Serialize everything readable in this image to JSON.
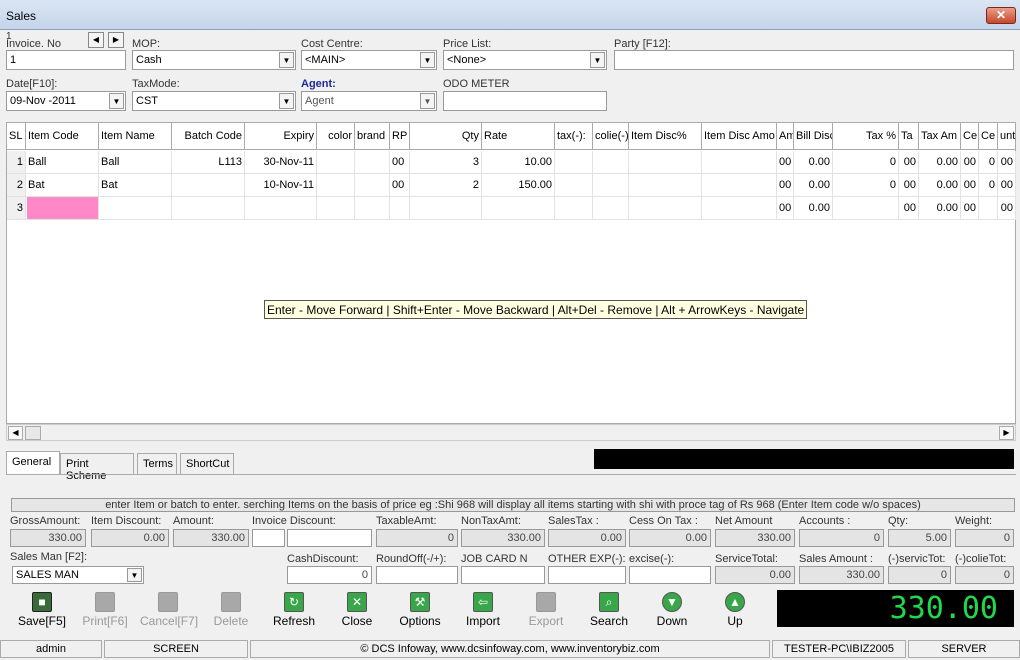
{
  "window": {
    "title": "Sales",
    "close_symbol": "✕"
  },
  "header": {
    "row_marker": "1",
    "invoice_label": "Invoice. No",
    "invoice_value": "1",
    "mop_label": "MOP:",
    "mop_value": "Cash",
    "cost_centre_label": "Cost Centre:",
    "cost_centre_value": "<MAIN>",
    "price_list_label": "Price List:",
    "price_list_value": "<None>",
    "party_label": "Party [F12]:",
    "party_value": "",
    "date_label": "Date[F10]:",
    "date_value": "09-Nov -2011",
    "taxmode_label": "TaxMode:",
    "taxmode_value": "CST",
    "agent_label": "Agent:",
    "agent_value": "Agent",
    "odo_label": "ODO METER",
    "odo_value": ""
  },
  "grid": {
    "columns": [
      "SL",
      "Item Code",
      "Item Name",
      "Batch Code",
      "Expiry",
      "color",
      "brand",
      "RP",
      "Qty",
      "Rate",
      "tax(-):",
      "colie(-):",
      "Item Disc%",
      "Item Disc Amo",
      "Am",
      "Bill Disc",
      "Tax %",
      "Ta",
      "Tax Am",
      "Ce",
      "Ce",
      "unt"
    ],
    "rows": [
      [
        "1",
        "Ball",
        "Ball",
        "L113",
        "30-Nov-11",
        "",
        "",
        "00",
        "3",
        "10.00",
        "",
        "",
        "",
        "",
        "00",
        "0.00",
        "0",
        "00",
        "0.00",
        "00",
        "0",
        "00"
      ],
      [
        "2",
        "Bat",
        "Bat",
        "",
        "10-Nov-11",
        "",
        "",
        "00",
        "2",
        "150.00",
        "",
        "",
        "",
        "",
        "00",
        "0.00",
        "0",
        "00",
        "0.00",
        "00",
        "0",
        "00"
      ],
      [
        "3",
        "",
        "",
        "",
        "",
        "",
        "",
        "",
        "",
        "",
        "",
        "",
        "",
        "",
        "00",
        "0.00",
        "",
        "00",
        "0.00",
        "00",
        "",
        "00"
      ]
    ],
    "hint": "Enter -  Move Forward | Shift+Enter - Move Backward |  Alt+Del - Remove | Alt + ArrowKeys - Navigate"
  },
  "tabs": [
    "General",
    "Print Scheme",
    "Terms",
    "ShortCut"
  ],
  "info": "enter Item or batch to enter. serching Items on the basis of price eg :Shi 968 will display all items starting with shi with proce tag of Rs 968 (Enter Item code w/o spaces)",
  "summary": {
    "gross_label": "GrossAmount:",
    "gross_value": "330.00",
    "item_disc_label": "Item Discount:",
    "item_disc_value": "0.00",
    "amount_label": "Amount:",
    "amount_value": "330.00",
    "inv_disc_label": "Invoice Discount:",
    "inv_disc_value": "",
    "taxable_label": "TaxableAmt:",
    "taxable_value": "0",
    "nontax_label": "NonTaxAmt:",
    "nontax_value": "330.00",
    "salestax_label": "SalesTax :",
    "salestax_value": "0.00",
    "cess_label": "Cess On Tax :",
    "cess_value": "0.00",
    "net_label": "Net Amount",
    "net_value": "330.00",
    "accounts_label": "Accounts :",
    "accounts_value": "0",
    "qty_label": "Qty:",
    "qty_value": "5.00",
    "weight_label": "Weight:",
    "weight_value": "0",
    "salesman_label": "Sales Man [F2]:",
    "salesman_value": "SALES MAN",
    "cash_disc_label": "CashDiscount:",
    "cash_disc_value": "0",
    "roundoff_label": "RoundOff(-/+):",
    "roundoff_value": "",
    "jobcard_label": "JOB CARD N",
    "jobcard_value": "",
    "otherexp_label": "OTHER EXP(-):",
    "otherexp_value": "",
    "excise_label": "excise(-):",
    "excise_value": "",
    "service_total_label": "ServiceTotal:",
    "service_total_value": "0.00",
    "sales_amount_label": "Sales Amount :",
    "sales_amount_value": "330.00",
    "servic_tot_label": "(-)servicTot:",
    "servic_tot_value": "0",
    "colie_tot_label": "(-)colieTot:",
    "colie_tot_value": "0"
  },
  "toolbar": {
    "save": "Save[F5]",
    "print": "Print[F6]",
    "cancel": "Cancel[F7]",
    "delete": "Delete",
    "refresh": "Refresh",
    "close": "Close",
    "options": "Options",
    "import": "Import",
    "export": "Export",
    "search": "Search",
    "down": "Down",
    "up": "Up"
  },
  "total": "330.00",
  "status": {
    "user": "admin",
    "screen": "SCREEN",
    "copyright": "© DCS Infoway, www.dcsinfoway.com, www.inventorybiz.com",
    "machine": "TESTER-PC\\IBIZ2005",
    "server": "SERVER"
  },
  "colors": {
    "highlight_cell": "#ff88c8",
    "total_text": "#1fd84b",
    "agent_label": "#1a2a9c"
  }
}
